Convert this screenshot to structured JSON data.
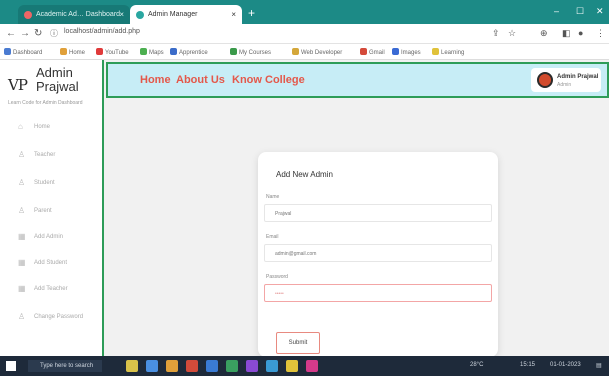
{
  "browser": {
    "tabs": [
      {
        "title": "Academic Ad… Dashboard"
      },
      {
        "title": "Admin Manager"
      }
    ],
    "new_tab": "+",
    "url": "localhost/admin/add.php",
    "bookmarks": [
      "Dashboard",
      "Home",
      "YouTube",
      "Maps",
      "Apprentice",
      "My Courses",
      "Web Developer",
      "Gmail",
      "Images",
      "Learning"
    ]
  },
  "sidebar": {
    "logo": "VP",
    "brand": "Admin Prajwal",
    "subtitle": "Learn Code for Admin Dashboard",
    "items": [
      {
        "label": "Home",
        "icon": "home-icon"
      },
      {
        "label": "Teacher",
        "icon": "person-icon"
      },
      {
        "label": "Student",
        "icon": "person-icon"
      },
      {
        "label": "Parent",
        "icon": "person-icon"
      },
      {
        "label": "Add Admin",
        "icon": "grid-icon"
      },
      {
        "label": "Add Student",
        "icon": "grid-icon"
      },
      {
        "label": "Add Teacher",
        "icon": "grid-icon"
      },
      {
        "label": "Change Password",
        "icon": "person-icon"
      }
    ]
  },
  "topnav": {
    "links": [
      "Home",
      "About Us",
      "Know College"
    ],
    "user_name": "Admin Prajwal",
    "user_role": "Admin"
  },
  "form": {
    "title": "Add New Admin",
    "name_label": "Name",
    "name_value": "Prajwal",
    "email_label": "Email",
    "email_value": "admin@gmail.com",
    "password_label": "Password",
    "password_value": "•••••",
    "submit_label": "Submit"
  },
  "taskbar": {
    "search_placeholder": "Type here to search",
    "weather": "28°C",
    "time": "15:15",
    "date": "01-01-2023"
  },
  "colors": {
    "accent": "#2e9c58",
    "nav_bg": "#c7edf6",
    "nav_text": "#e4584a"
  }
}
